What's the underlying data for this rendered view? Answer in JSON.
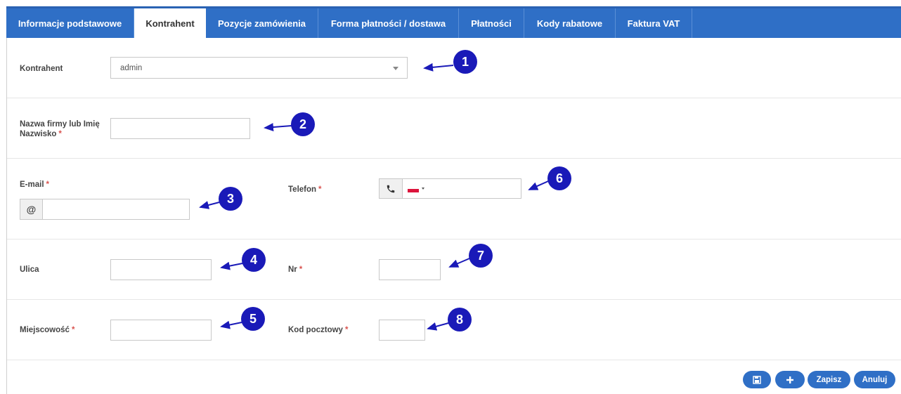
{
  "tabs": [
    {
      "label": "Informacje podstawowe",
      "active": false
    },
    {
      "label": "Kontrahent",
      "active": true
    },
    {
      "label": "Pozycje zamówienia",
      "active": false
    },
    {
      "label": "Forma płatności / dostawa",
      "active": false
    },
    {
      "label": "Płatności",
      "active": false
    },
    {
      "label": "Kody rabatowe",
      "active": false
    },
    {
      "label": "Faktura VAT",
      "active": false
    }
  ],
  "form": {
    "kontrahent": {
      "label": "Kontrahent",
      "value": "admin"
    },
    "company_name": {
      "label_line1": "Nazwa firmy lub Imię",
      "label_line2": "Nazwisko",
      "required_mark": "*",
      "value": ""
    },
    "email": {
      "label": "E-mail",
      "required_mark": "*",
      "addon": "@",
      "value": ""
    },
    "phone": {
      "label": "Telefon",
      "required_mark": "*",
      "value": "",
      "icon": "phone-icon",
      "flag": "poland-flag"
    },
    "street": {
      "label": "Ulica",
      "value": ""
    },
    "number": {
      "label": "Nr",
      "required_mark": "*",
      "value": ""
    },
    "city": {
      "label": "Miejscowość",
      "required_mark": "*",
      "value": ""
    },
    "postal_code": {
      "label": "Kod pocztowy",
      "required_mark": "*",
      "value": ""
    }
  },
  "callouts": [
    "1",
    "2",
    "3",
    "4",
    "5",
    "6",
    "7",
    "8"
  ],
  "buttons": {
    "save_as_icon": "save-as-icon",
    "add_icon": "plus-icon",
    "save_label": "Zapisz",
    "cancel_label": "Anuluj"
  },
  "colors": {
    "tab_bar": "#2f6fc6",
    "callout": "#1a1ab8",
    "required": "#d9534f",
    "flag_red": "#dc143c"
  }
}
